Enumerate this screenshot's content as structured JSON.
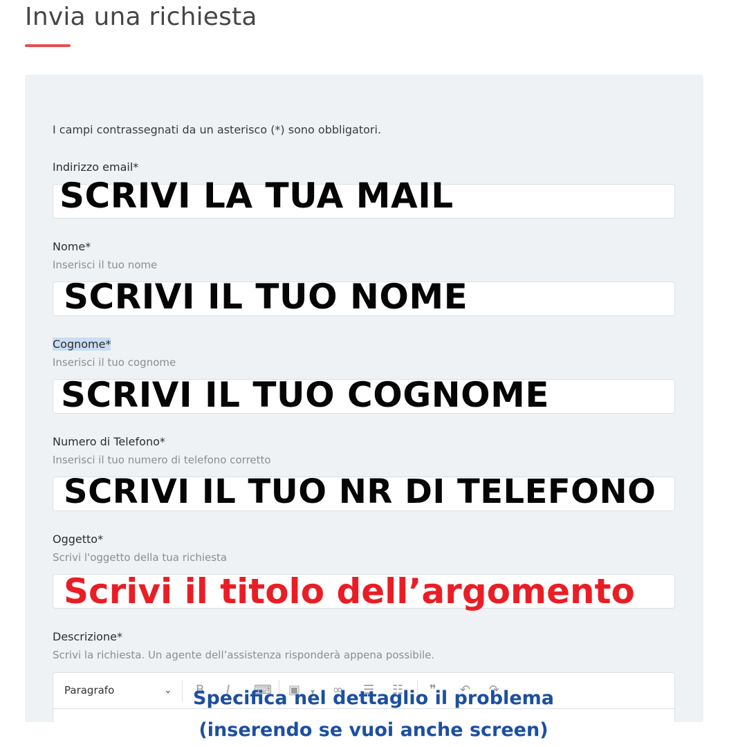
{
  "page": {
    "title": "Invia una richiesta",
    "required_note": "I campi contrassegnati da un asterisco (*) sono obbligatori."
  },
  "fields": {
    "email": {
      "label": "Indirizzo email*",
      "overlay": "SCRIVI LA TUA MAIL"
    },
    "nome": {
      "label": "Nome*",
      "hint": "Inserisci il tuo nome",
      "overlay": "SCRIVI IL TUO NOME"
    },
    "cognome": {
      "label": "Cognome*",
      "hint": "Inserisci il tuo cognome",
      "overlay": "SCRIVI IL TUO COGNOME"
    },
    "telefono": {
      "label": "Numero di Telefono*",
      "hint": "Inserisci il tuo numero di telefono corretto",
      "overlay": "SCRIVI IL TUO NR DI TELEFONO"
    },
    "oggetto": {
      "label": "Oggetto*",
      "hint": "Scrivi l'oggetto della tua richiesta",
      "overlay": "Scrivi il titolo dell’argomento"
    },
    "descrizione": {
      "label": "Descrizione*",
      "hint": "Scrivi la richiesta. Un agente dell’assistenza risponderà appena possibile.",
      "paragraph_select": "Paragrafo"
    }
  },
  "annotation": {
    "line1": "Specifica nel dettaglio il problema",
    "line2": "(inserendo se vuoi anche screen)"
  },
  "colors": {
    "accent_red": "#e84c4c",
    "overlay_red": "#ea1d25",
    "overlay_blue": "#1c4fa0",
    "panel_bg": "#eff2f4"
  },
  "toolbar_icons": [
    "bold-icon",
    "italic-icon",
    "code-icon",
    "code-block-icon",
    "link-icon",
    "bullet-list-icon",
    "numbered-list-icon",
    "quote-icon",
    "undo-icon",
    "redo-icon"
  ]
}
